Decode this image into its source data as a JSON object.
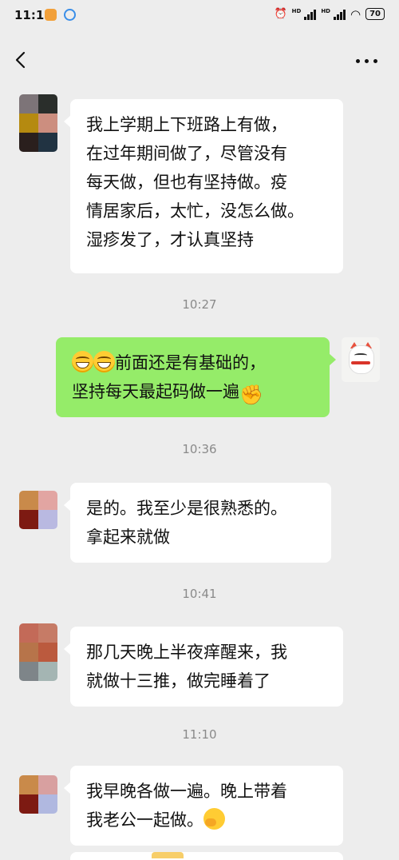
{
  "status_bar": {
    "time": "11:11",
    "battery": "70",
    "hd1": "HD",
    "hd2": "HD"
  },
  "nav": {
    "back_icon": "chevron-left-icon",
    "more_icon": "more-dots-icon"
  },
  "messages": [
    {
      "side": "left",
      "lines": [
        "我上学期上下班路上有做，",
        "在过年期间做了，尽管没有",
        "每天做，但也有坚持做。疫",
        "情居家后，太忙，没怎么做。",
        "湿疹发了，才认真坚持"
      ]
    },
    {
      "side": "right",
      "line1_text": "前面还是有基础的，",
      "line2_text": "坚持每天最起码做一遍",
      "emojis": [
        "grin-emoji",
        "grin-emoji",
        "fist-emoji"
      ]
    },
    {
      "side": "left",
      "lines": [
        "是的。我至少是很熟悉的。",
        "拿起来就做"
      ]
    },
    {
      "side": "left",
      "lines": [
        "那几天晚上半夜痒醒来，我",
        "就做十三推，做完睡着了"
      ]
    },
    {
      "side": "left",
      "line1_text": "我早晚各做一遍。晚上带着",
      "line2_text": "我老公一起做。",
      "emojis": [
        "thinking-emoji"
      ]
    }
  ],
  "timestamps": [
    "10:27",
    "10:36",
    "10:41",
    "11:10"
  ],
  "colors": {
    "background": "#ededed",
    "incoming_bubble": "#ffffff",
    "outgoing_bubble": "#95ec69",
    "timestamp": "#8a8a8a"
  }
}
